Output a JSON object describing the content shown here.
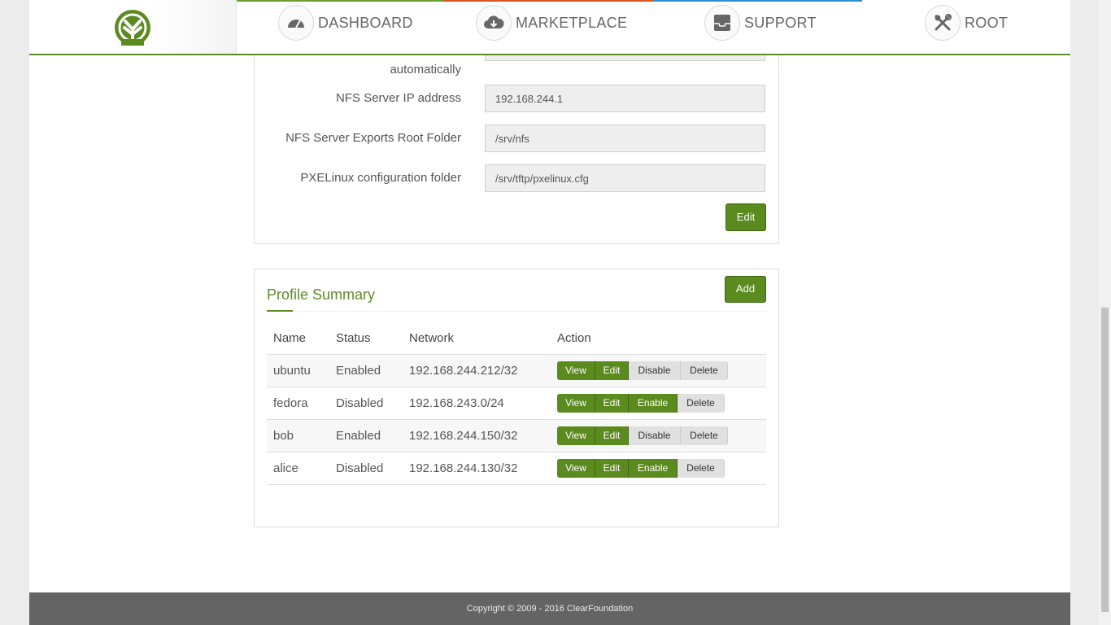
{
  "header": {
    "nav": [
      {
        "label": "DASHBOARD",
        "icon": "speedometer-icon",
        "accent": "#6a9e2e"
      },
      {
        "label": "MARKETPLACE",
        "icon": "cloud-download-icon",
        "accent": "#d9531e"
      },
      {
        "label": "SUPPORT",
        "icon": "inbox-icon",
        "accent": "#2b8fd6"
      },
      {
        "label": "ROOT",
        "icon": "tools-icon",
        "accent": "#c8c8c8"
      }
    ]
  },
  "settings": {
    "partial_label": "automatically",
    "fields": [
      {
        "label": "NFS Server IP address",
        "value": "192.168.244.1"
      },
      {
        "label": "NFS Server Exports Root Folder",
        "value": "/srv/nfs"
      },
      {
        "label": "PXELinux configuration folder",
        "value": "/srv/tftp/pxelinux.cfg"
      }
    ],
    "edit_label": "Edit"
  },
  "profiles": {
    "title": "Profile Summary",
    "add_label": "Add",
    "columns": [
      "Name",
      "Status",
      "Network",
      "Action"
    ],
    "rows": [
      {
        "name": "ubuntu",
        "status": "Enabled",
        "network": "192.168.244.212/32",
        "actions": [
          "View",
          "Edit",
          "Disable",
          "Delete"
        ]
      },
      {
        "name": "fedora",
        "status": "Disabled",
        "network": "192.168.243.0/24",
        "actions": [
          "View",
          "Edit",
          "Enable",
          "Delete"
        ]
      },
      {
        "name": "bob",
        "status": "Enabled",
        "network": "192.168.244.150/32",
        "actions": [
          "View",
          "Edit",
          "Disable",
          "Delete"
        ]
      },
      {
        "name": "alice",
        "status": "Disabled",
        "network": "192.168.244.130/32",
        "actions": [
          "View",
          "Edit",
          "Enable",
          "Delete"
        ]
      }
    ]
  },
  "footer": {
    "copyright": "Copyright © 2009 - 2016 ClearFoundation"
  },
  "colors": {
    "brand_green": "#5b8a1f",
    "footer_bg": "#646464"
  }
}
